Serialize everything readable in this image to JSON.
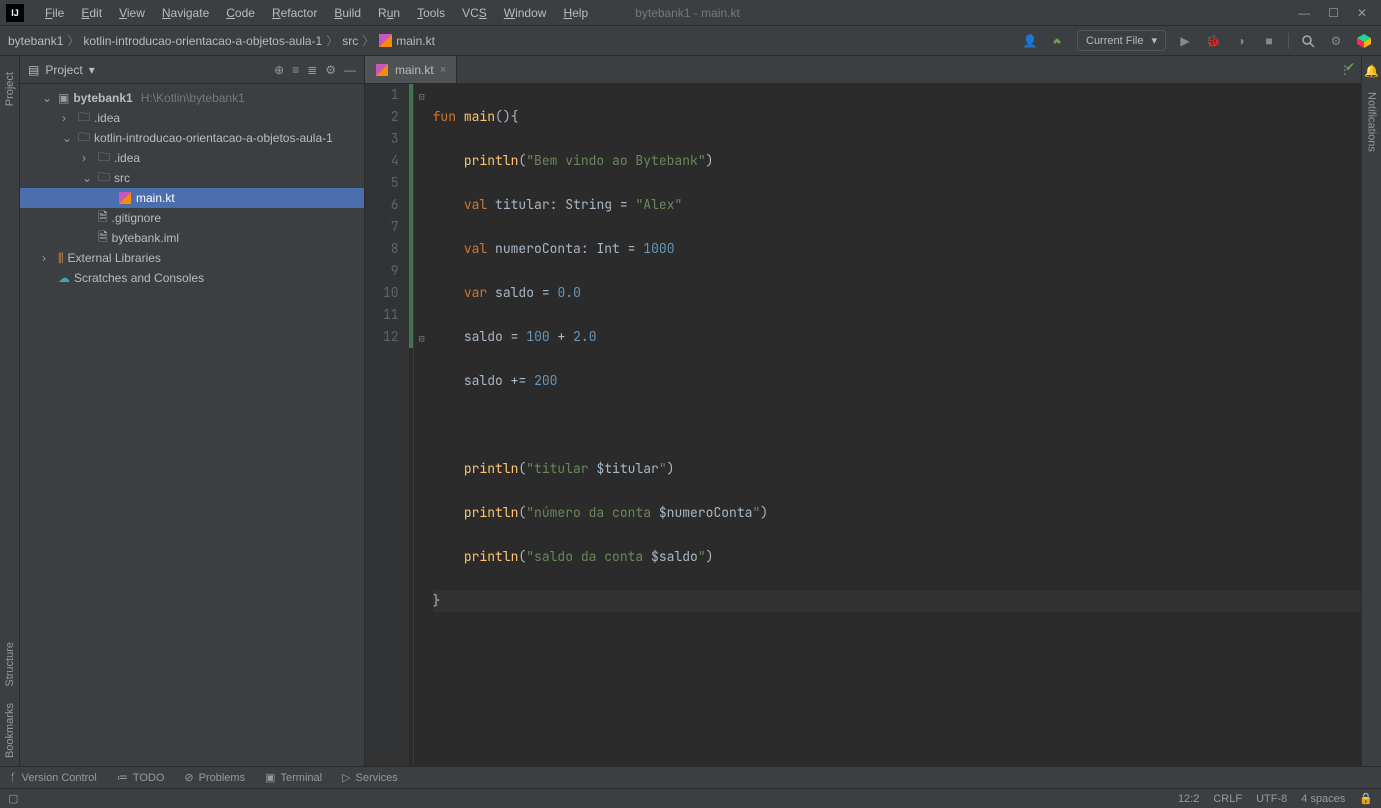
{
  "window": {
    "title": "bytebank1 - main.kt"
  },
  "menu": [
    "File",
    "Edit",
    "View",
    "Navigate",
    "Code",
    "Refactor",
    "Build",
    "Run",
    "Tools",
    "VCS",
    "Window",
    "Help"
  ],
  "breadcrumbs": [
    "bytebank1",
    "kotlin-introducao-orientacao-a-objetos-aula-1",
    "src",
    "main.kt"
  ],
  "run_config": {
    "label": "Current File"
  },
  "sidebar": {
    "title": "Project",
    "root": {
      "name": "bytebank1",
      "path": "H:\\Kotlin\\bytebank1"
    },
    "folder_idea": ".idea",
    "folder_module": "kotlin-introducao-orientacao-a-objetos-aula-1",
    "folder_idea2": ".idea",
    "folder_src": "src",
    "file_main": "main.kt",
    "file_gitignore": ".gitignore",
    "file_iml": "bytebank.iml",
    "external_libs": "External Libraries",
    "scratches": "Scratches and Consoles"
  },
  "tab": {
    "filename": "main.kt"
  },
  "code": {
    "l1": {
      "kw": "fun",
      "fn": "main",
      "rest": "(){"
    },
    "l2": {
      "fn": "println",
      "str": "\"Bem vindo ao Bytebank\""
    },
    "l3": {
      "kw": "val",
      "name": "titular",
      "type": "String",
      "eq": "=",
      "str": "\"Alex\""
    },
    "l4": {
      "kw": "val",
      "name": "numeroConta",
      "type": "Int",
      "eq": "=",
      "num": "1000"
    },
    "l5": {
      "kw": "var",
      "name": "saldo",
      "eq": "=",
      "num": "0.0"
    },
    "l6": {
      "name": "saldo",
      "eq": "=",
      "n1": "100",
      "op": "+",
      "n2": "2.0"
    },
    "l7": {
      "name": "saldo",
      "op": "+=",
      "num": "200"
    },
    "l9": {
      "fn": "println",
      "s1": "\"titular ",
      "v": "$titular",
      "s2": "\""
    },
    "l10": {
      "fn": "println",
      "s1": "\"número da conta ",
      "v": "$numeroConta",
      "s2": "\""
    },
    "l11": {
      "fn": "println",
      "s1": "\"saldo da conta ",
      "v": "$saldo",
      "s2": "\""
    },
    "l12": {
      "brace": "}"
    }
  },
  "line_numbers": [
    "1",
    "2",
    "3",
    "4",
    "5",
    "6",
    "7",
    "8",
    "9",
    "10",
    "11",
    "12"
  ],
  "bottom": {
    "vcs": "Version Control",
    "todo": "TODO",
    "problems": "Problems",
    "terminal": "Terminal",
    "services": "Services"
  },
  "status": {
    "pos": "12:2",
    "crlf": "CRLF",
    "enc": "UTF-8",
    "indent": "4 spaces"
  },
  "rails": {
    "project": "Project",
    "structure": "Structure",
    "bookmarks": "Bookmarks",
    "notifications": "Notifications"
  }
}
